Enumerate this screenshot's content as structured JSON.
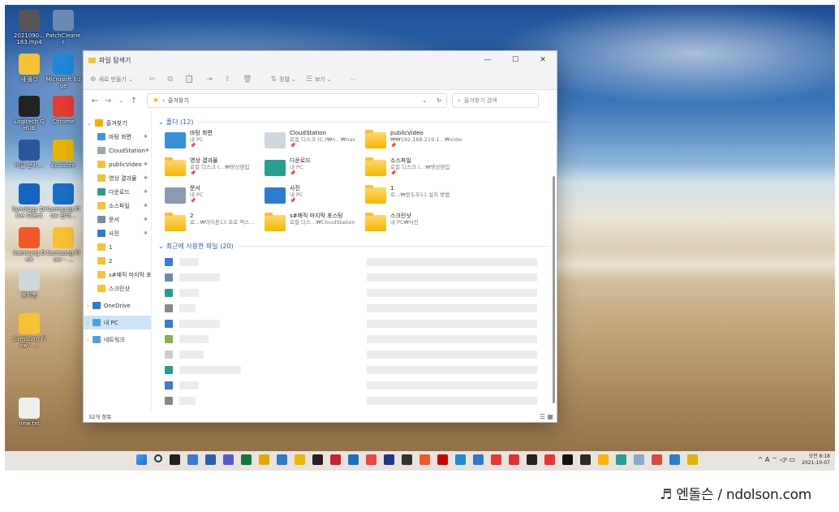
{
  "desktop": {
    "icons": [
      {
        "label": "2021090…\n183.mp4",
        "color": "#555"
      },
      {
        "label": "PatchCleaner",
        "color": "#6c8ab0"
      },
      {
        "label": "새 폴더",
        "color": "#f5c233"
      },
      {
        "label": "Microsoft Edge",
        "color": "#1e88d9"
      },
      {
        "label": "Logitech G HUB",
        "color": "#222"
      },
      {
        "label": "Chrome",
        "color": "#e33b2e"
      },
      {
        "label": "비밀 문서…",
        "color": "#2b579a"
      },
      {
        "label": "Ecoisten",
        "color": "#e9b400"
      },
      {
        "label": "Synology Drive Client",
        "color": "#1565c0"
      },
      {
        "label": "Samsung Flow 관리…",
        "color": "#1b6ec2"
      },
      {
        "label": "Samsung DeX",
        "color": "#f05a28"
      },
      {
        "label": "Samsung Flow - …",
        "color": "#f5c233"
      },
      {
        "label": "휴지통",
        "color": "#cfd8dc"
      },
      {
        "label": "Samsung Flow - …",
        "color": "#f5c233"
      },
      {
        "label": "new.txt",
        "color": "#eee"
      }
    ]
  },
  "explorer": {
    "title": "파일 탐색기",
    "window_controls": [
      "—",
      "☐",
      "✕"
    ],
    "commands": [
      {
        "icon": "⊕",
        "label": "새로 만들기",
        "chevron": "⌄"
      },
      {
        "icon": "✂",
        "label": ""
      },
      {
        "icon": "⧉",
        "label": ""
      },
      {
        "icon": "📋",
        "label": ""
      },
      {
        "icon": "⇥",
        "label": ""
      },
      {
        "icon": "⇪",
        "label": ""
      },
      {
        "icon": "🗑",
        "label": ""
      },
      {
        "icon": "⇅",
        "label": "정렬",
        "chevron": "⌄"
      },
      {
        "icon": "☰",
        "label": "보기",
        "chevron": "⌄"
      },
      {
        "icon": "",
        "label": "···"
      }
    ],
    "address": {
      "path": "즐겨찾기",
      "sep": "›"
    },
    "search": {
      "placeholder": "즐겨찾기 검색"
    },
    "nav": [
      {
        "label": "즐겨찾기",
        "top": true,
        "color": "#f0b400",
        "sel": false
      },
      {
        "label": "바탕 화면",
        "color": "#4a90e2",
        "pin": true
      },
      {
        "label": "CloudStation",
        "color": "#9aa",
        "pin": true
      },
      {
        "label": "publicVideo",
        "color": "#f5c233",
        "pin": true
      },
      {
        "label": "영상 결과물",
        "color": "#f5c233",
        "pin": true
      },
      {
        "label": "다운로드",
        "color": "#2a9d8f",
        "pin": true
      },
      {
        "label": "소스파일",
        "color": "#f5c233",
        "pin": true
      },
      {
        "label": "문서",
        "color": "#7a8ca0",
        "pin": true
      },
      {
        "label": "사진",
        "color": "#2b7bd0",
        "pin": true
      },
      {
        "label": "1",
        "color": "#f5c233"
      },
      {
        "label": "2",
        "color": "#f5c233"
      },
      {
        "label": "s#매직 마지막 포스",
        "color": "#f5c233"
      },
      {
        "label": "스크린샷",
        "color": "#f5c233"
      },
      {
        "label": "OneDrive",
        "top": true,
        "color": "#2b7bd0",
        "chev": "›"
      },
      {
        "label": "내 PC",
        "top": true,
        "color": "#4aa3df",
        "chev": "›",
        "sel": true
      },
      {
        "label": "네트워크",
        "top": true,
        "color": "#4aa3df",
        "chev": "›"
      }
    ],
    "folders_header": "폴더 (12)",
    "folders": [
      {
        "name": "바탕 화면",
        "sub": "내 PC",
        "pin": "📌",
        "color": "#3a8fd6"
      },
      {
        "name": "CloudStation",
        "sub": "로컬 디스크 (C:)₩n…₩nas",
        "pin": "📌",
        "color": "#cfd8dc"
      },
      {
        "name": "publicVideo",
        "sub": "₩₩192.168.219.1…₩video",
        "pin": "📌",
        "color": "#f5c233"
      },
      {
        "name": "영상 결과물",
        "sub": "로컬 디스크 (…₩영상편집",
        "pin": "📌",
        "color": "#f5c233"
      },
      {
        "name": "다운로드",
        "sub": "내 PC",
        "pin": "📌",
        "color": "#2a9d8f"
      },
      {
        "name": "소스파일",
        "sub": "로컬 디스크 (…₩영상편집",
        "pin": "📌",
        "color": "#f5c233"
      },
      {
        "name": "문서",
        "sub": "내 PC",
        "pin": "📌",
        "color": "#8a9bb0"
      },
      {
        "name": "사진",
        "sub": "내 PC",
        "pin": "📌",
        "color": "#2b7bd0"
      },
      {
        "name": "1",
        "sub": "로…₩윈도우11 설치 방법",
        "pin": "",
        "color": "#f5c233"
      },
      {
        "name": "2",
        "sub": "로…₩아이폰13 프로 맥스…",
        "pin": "",
        "color": "#f5c233"
      },
      {
        "name": "s#매직 마지막 포스팅",
        "sub": "로컬 디스…₩CloudStation",
        "pin": "",
        "color": "#f5c233"
      },
      {
        "name": "스크린샷",
        "sub": "내 PC₩사진",
        "pin": "",
        "color": "#f5c233"
      }
    ],
    "recent_header": "최근에 사용한 파일 (20)",
    "recent_count": 10,
    "status": "32개 항목",
    "views": "☰ ▦"
  },
  "taskbar": {
    "apps": [
      "#1c6fd1",
      "#333",
      "#222",
      "#3a7bd5",
      "#2b5fa8",
      "#5559d6",
      "#0f7a3a",
      "#e6a700",
      "#2b7bd0",
      "#f0b400",
      "#222",
      "#c23",
      "#1b6ec2",
      "#e44",
      "#1b3a8a",
      "#333",
      "#f05a28",
      "#c00",
      "#1e88d9",
      "#2b7bd0",
      "#e33b2e",
      "#d33",
      "#222",
      "#e33",
      "#111",
      "#2b2b2b",
      "#ffb400",
      "#2a9d8f",
      "#8ac",
      "#d44",
      "#2b7bd0",
      "#e2b400"
    ],
    "tray_icons": "^ A ⌔ ◁ᵡ ▭",
    "time": "오전 8:18",
    "date": "2021-10-07"
  },
  "watermark": "♬ 엔돌슨 / ndolson.com"
}
